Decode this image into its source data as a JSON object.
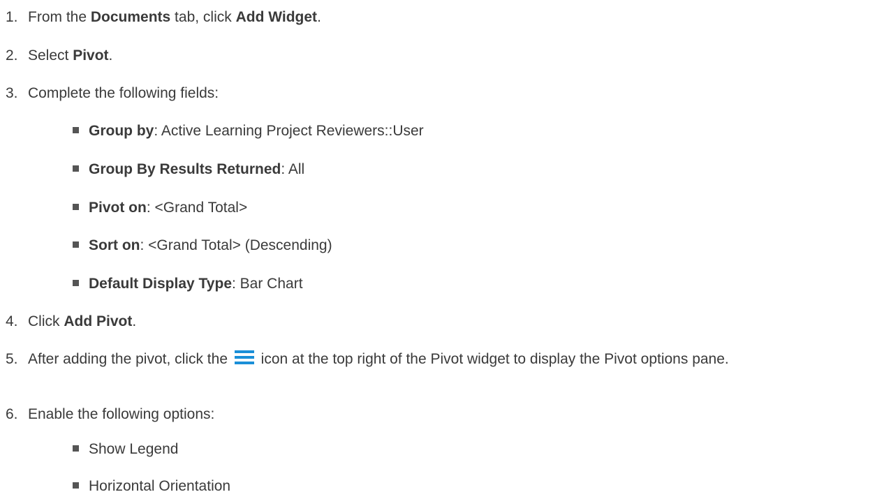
{
  "steps": [
    {
      "num": "1.",
      "pre": "From the ",
      "b1": "Documents",
      "mid": " tab, click ",
      "b2": "Add Widget",
      "post": "."
    },
    {
      "num": "2.",
      "pre": "Select ",
      "b1": "Pivot",
      "post": "."
    },
    {
      "num": "3.",
      "text": "Complete the following fields:"
    },
    {
      "num": "4.",
      "pre": "Click ",
      "b1": "Add Pivot",
      "post": "."
    },
    {
      "num": "5.",
      "pre": "After adding the pivot, click the ",
      "post": " icon at the top right of the Pivot widget to display the Pivot options pane."
    },
    {
      "num": "6.",
      "text": "Enable the following options:"
    }
  ],
  "fields": [
    {
      "label": "Group by",
      "value": ": Active Learning Project Reviewers::User"
    },
    {
      "label": "Group By Results Returned",
      "value": ": All"
    },
    {
      "label": "Pivot on",
      "value": ": <Grand Total>"
    },
    {
      "label": "Sort on",
      "value": ": <Grand Total> (Descending)"
    },
    {
      "label": "Default Display Type",
      "value": ": Bar Chart"
    }
  ],
  "options": [
    {
      "text": "Show Legend"
    },
    {
      "text": "Horizontal Orientation"
    }
  ],
  "colors": {
    "menu_icon": "#1a8fd8"
  },
  "icons": {
    "menu": "hamburger-menu-icon"
  }
}
